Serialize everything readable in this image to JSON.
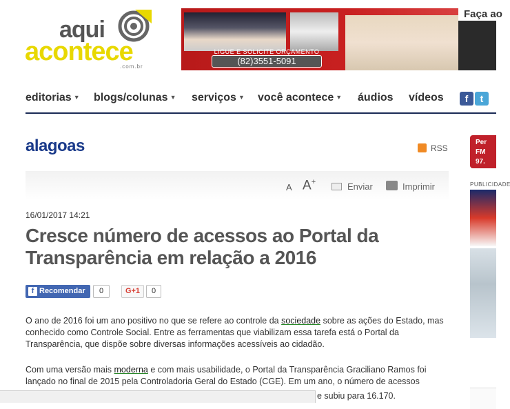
{
  "logo": {
    "line1": "aqui",
    "line2": "acontece",
    "domain": ".com.br"
  },
  "banner": {
    "tagline": "LIGUE E SOLICITE ORÇAMENTO",
    "phone": "(82)3551-5091",
    "corner_text": "Faça ao"
  },
  "nav": {
    "items": [
      {
        "label": "editorias",
        "has_dropdown": true
      },
      {
        "label": "blogs/colunas",
        "has_dropdown": true
      },
      {
        "label": "serviços",
        "has_dropdown": true
      },
      {
        "label": "você acontece",
        "has_dropdown": true
      },
      {
        "label": "áudios",
        "has_dropdown": false
      },
      {
        "label": "vídeos",
        "has_dropdown": false
      }
    ],
    "social": {
      "facebook": "f",
      "twitter": "t"
    }
  },
  "section": {
    "title": "alagoas",
    "rss_label": "RSS"
  },
  "toolbar": {
    "font_smaller": "A",
    "font_larger": "A",
    "font_larger_sup": "+",
    "email_label": "Enviar",
    "print_label": "Imprimir"
  },
  "article": {
    "date": "16/01/2017 14:21",
    "title": "Cresce número de acessos ao Portal da Transparência em relação a 2016",
    "share": {
      "fb_label": "Recomendar",
      "fb_icon": "f",
      "fb_count": "0",
      "gplus_label": "G+1",
      "gplus_count": "0"
    },
    "p1": {
      "before": "O ano de 2016 foi um ano positivo no que se refere ao controle da ",
      "link": "sociedade",
      "after": " sobre as ações do Estado, mas conhecido como Controle Social. Entre as ferramentas que viabilizam essa tarefa está o Portal da Transparência, que dispõe sobre diversas informações acessíveis ao cidadão."
    },
    "p2": {
      "before": "Com uma versão mais ",
      "link": "moderna",
      "after": " e com mais usabilidade, o Portal da Transparência Graciliano Ramos foi lançado no final de 2015 pela Controladoria Geral do Estado (CGE). Em um ano, o número de acessos"
    },
    "p3_visible": "e subiu para 16.170."
  },
  "sidebar": {
    "radio_label": "Per FM 97.",
    "pub_label": "PUBLICIDADE"
  },
  "colors": {
    "nav_border": "#1a2a55",
    "section_title": "#1a3a8a",
    "logo_yellow": "#e8d800",
    "fb_blue": "#4267b2"
  }
}
